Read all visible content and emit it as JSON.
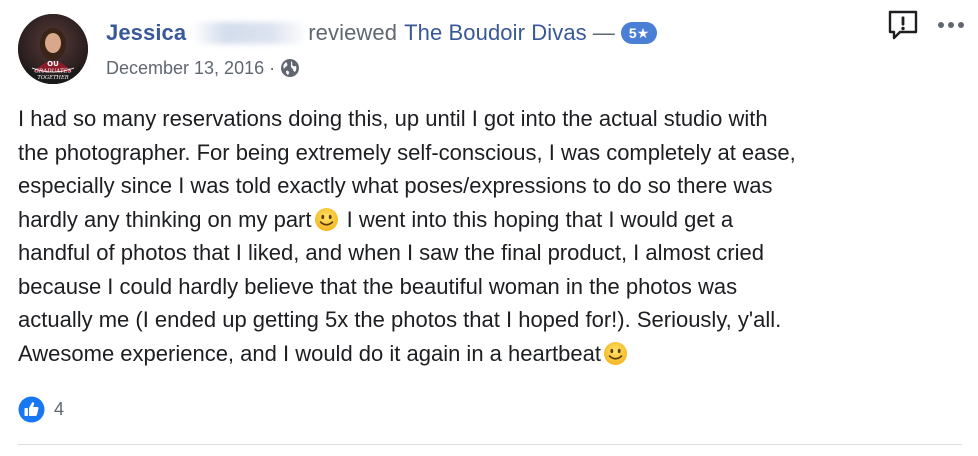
{
  "post": {
    "author_first_name": "Jessica",
    "reviewed_text": "reviewed",
    "page_name": "The Boudoir Divas",
    "dash": "—",
    "rating_badge": "5★",
    "date": "December 13, 2016",
    "meta_separator": "·",
    "privacy_icon": "globe-icon",
    "avatar_caption": "GRADUATES TOGETHER",
    "avatar_monogram": "OU",
    "review_lines": [
      "I had so many reservations doing this, up until I got into the actual studio with",
      "the photographer. For being extremely self-conscious, I was completely at ease,",
      "especially since I was told exactly what poses/expressions to do so there was",
      "hardly any thinking on my part",
      " I went into this hoping that I would get a",
      "handful of photos that I liked, and when I saw the final product, I almost cried",
      "because I could hardly believe that the beautiful woman in the photos was",
      "actually me (I ended up getting 5x the photos that I hoped for!). Seriously, y'all.",
      "Awesome experience, and I would do it again in a heartbeat"
    ],
    "reactions": {
      "icon": "like-icon",
      "count": "4"
    }
  },
  "icons": {
    "report": "report-icon",
    "more": "more-options-icon"
  },
  "colors": {
    "link_blue": "#385898",
    "secondary_text": "#606770",
    "badge_blue": "#4a7fd6",
    "like_blue": "#1877f2",
    "text": "#1c1e21",
    "divider": "#dadde1"
  }
}
